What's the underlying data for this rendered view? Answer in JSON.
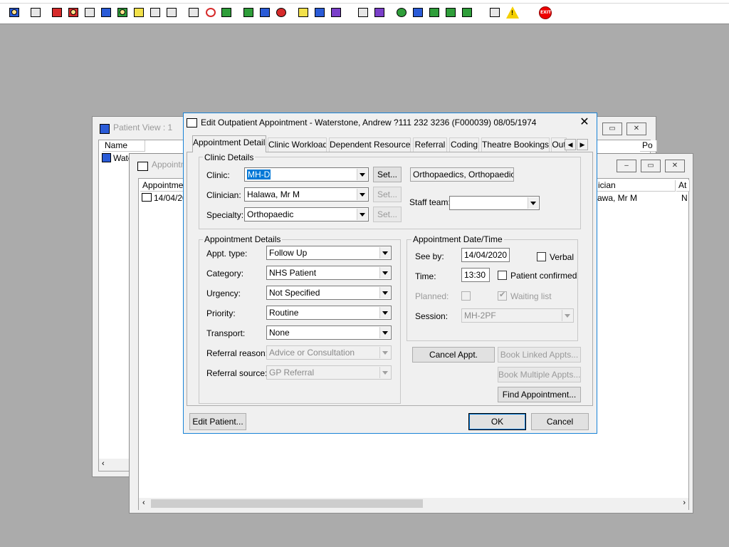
{
  "toolbar": {
    "icons": [
      "patient-icon",
      "print-icon",
      "book-icon",
      "folder-icon",
      "list-icon",
      "m-icon",
      "person-icon",
      "notes-icon",
      "flag-icon",
      "flag2-icon",
      "envelope-icon",
      "clock-icon",
      "screen-icon",
      "report-icon",
      "chart-icon",
      "globe-icon",
      "notepad-icon",
      "printer-icon",
      "person-edit-icon",
      "document-icon",
      "bar-chart-icon",
      "network-icon",
      "inbox-icon",
      "check-icon",
      "refresh-icon",
      "swap-icon",
      "warning-icon",
      "exit-icon"
    ],
    "warning_glyph": "!",
    "exit_label": "EXIT"
  },
  "patient_view": {
    "title": "Patient View : 1",
    "col_name": "Name",
    "col_po": "Po",
    "row_name": "Wate"
  },
  "appointments_window": {
    "title": "Appointm",
    "col_appointment": "Appointmen",
    "col_clinician": "ician",
    "col_at": "At",
    "row_date": "14/04/20",
    "row_clinician": "awa, Mr M",
    "row_at": "N"
  },
  "dialog": {
    "title": "Edit Outpatient Appointment - Waterstone, Andrew ?111 232 3236 (F000039) 08/05/1974",
    "tabs": [
      "Appointment Details",
      "Clinic Workload",
      "Dependent Resources",
      "Referral",
      "Coding",
      "Theatre Bookings",
      "Out"
    ],
    "clinic_details": {
      "group_label": "Clinic Details",
      "clinic_label": "Clinic:",
      "clinic_value": "MH-D",
      "clinic_set": "Set...",
      "clinic_desc": "Orthopaedics, Orthopaedic OP",
      "clinician_label": "Clinician:",
      "clinician_value": "Halawa, Mr M",
      "clinician_set": "Set...",
      "specialty_label": "Specialty:",
      "specialty_value": "Orthopaedic",
      "specialty_set": "Set...",
      "staff_team_label": "Staff team:",
      "staff_team_value": ""
    },
    "appointment_details": {
      "group_label": "Appointment Details",
      "appt_type_label": "Appt. type:",
      "appt_type_value": "Follow Up",
      "category_label": "Category:",
      "category_value": "NHS Patient",
      "urgency_label": "Urgency:",
      "urgency_value": "Not Specified",
      "priority_label": "Priority:",
      "priority_value": "Routine",
      "transport_label": "Transport:",
      "transport_value": "None",
      "referral_reason_label": "Referral reason:",
      "referral_reason_value": "Advice or Consultation",
      "referral_source_label": "Referral source:",
      "referral_source_value": "GP Referral"
    },
    "date_time": {
      "group_label": "Appointment Date/Time",
      "see_by_label": "See by:",
      "see_by_value": "14/04/2020",
      "verbal_label": "Verbal",
      "time_label": "Time:",
      "time_value": "13:30",
      "patient_confirmed_label": "Patient confirmed",
      "planned_label": "Planned:",
      "waiting_list_label": "Waiting list",
      "session_label": "Session:",
      "session_value": "MH-2PF"
    },
    "buttons": {
      "cancel_appt": "Cancel Appt.",
      "book_linked": "Book Linked Appts...",
      "book_multiple": "Book Multiple Appts...",
      "find_appointment": "Find Appointment...",
      "edit_patient": "Edit Patient...",
      "ok": "OK",
      "cancel": "Cancel"
    }
  }
}
